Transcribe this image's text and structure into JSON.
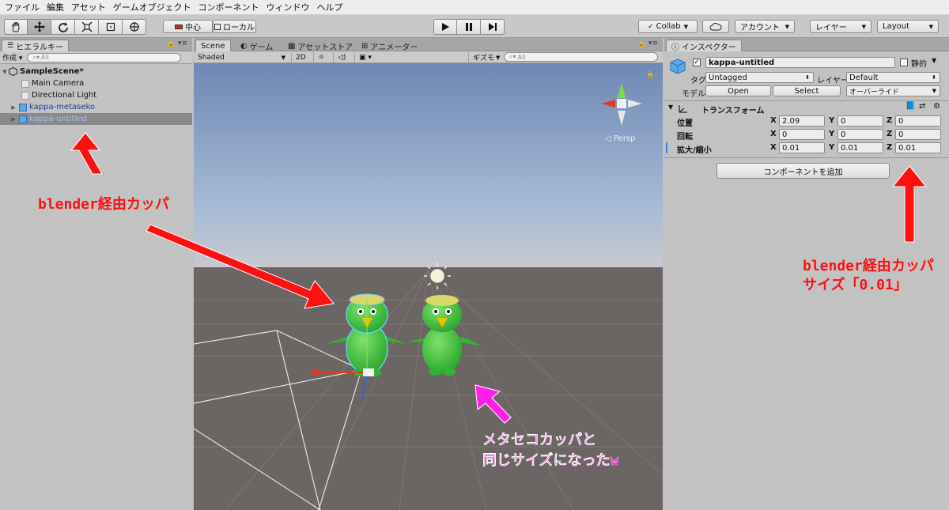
{
  "menu": [
    "ファイル",
    "編集",
    "アセット",
    "ゲームオブジェクト",
    "コンポーネント",
    "ウィンドウ",
    "ヘルプ"
  ],
  "toolbar": {
    "pivot_label": "中心",
    "space_label": "ローカル",
    "collab_label": "Collab",
    "account_label": "アカウント",
    "layers_label": "レイヤー",
    "layout_label": "Layout"
  },
  "hierarchy": {
    "tab_label": "ヒエラルキー",
    "create_label": "作成",
    "search_placeholder": "All",
    "scene_name": "SampleScene*",
    "items": [
      {
        "label": "Main Camera"
      },
      {
        "label": "Directional Light"
      },
      {
        "label": "kappa-metaseko"
      },
      {
        "label": "kappa-untitled"
      }
    ]
  },
  "scene": {
    "tabs": [
      "Scene",
      "ゲーム",
      "アセットストア",
      "アニメーター"
    ],
    "shading": "Shaded",
    "mode_2d": "2D",
    "gizmos_label": "ギズモ",
    "search_placeholder": "All",
    "persp_label": "Persp"
  },
  "inspector": {
    "tab_label": "インスペクター",
    "object_name": "kappa-untitled",
    "static_label": "静的",
    "tag_label": "タグ",
    "tag_value": "Untagged",
    "layer_label": "レイヤー",
    "layer_value": "Default",
    "model_label": "モデル",
    "open_label": "Open",
    "select_label": "Select",
    "override_label": "オーバーライド",
    "transform_label": "トランスフォーム",
    "position_label": "位置",
    "rotation_label": "回転",
    "scale_label": "拡大/縮小",
    "x": "X",
    "y": "Y",
    "z": "Z",
    "position": [
      "2.09",
      "0",
      "0"
    ],
    "rotation": [
      "0",
      "0",
      "0"
    ],
    "scale": [
      "0.01",
      "0.01",
      "0.01"
    ],
    "add_component_label": "コンポーネントを追加"
  },
  "annotations": {
    "left_note": "blender経由カッパ",
    "right_note_line1": "blender経由カッパ",
    "right_note_line2": "サイズ「0.01」",
    "bottom_note_line1": "メタセコカッパと",
    "bottom_note_line2": "同じサイズになったw"
  },
  "colors": {
    "annotation_red": "#ff1010",
    "annotation_magenta": "#ff1fe8",
    "kappa_green": "#3fc63a"
  }
}
